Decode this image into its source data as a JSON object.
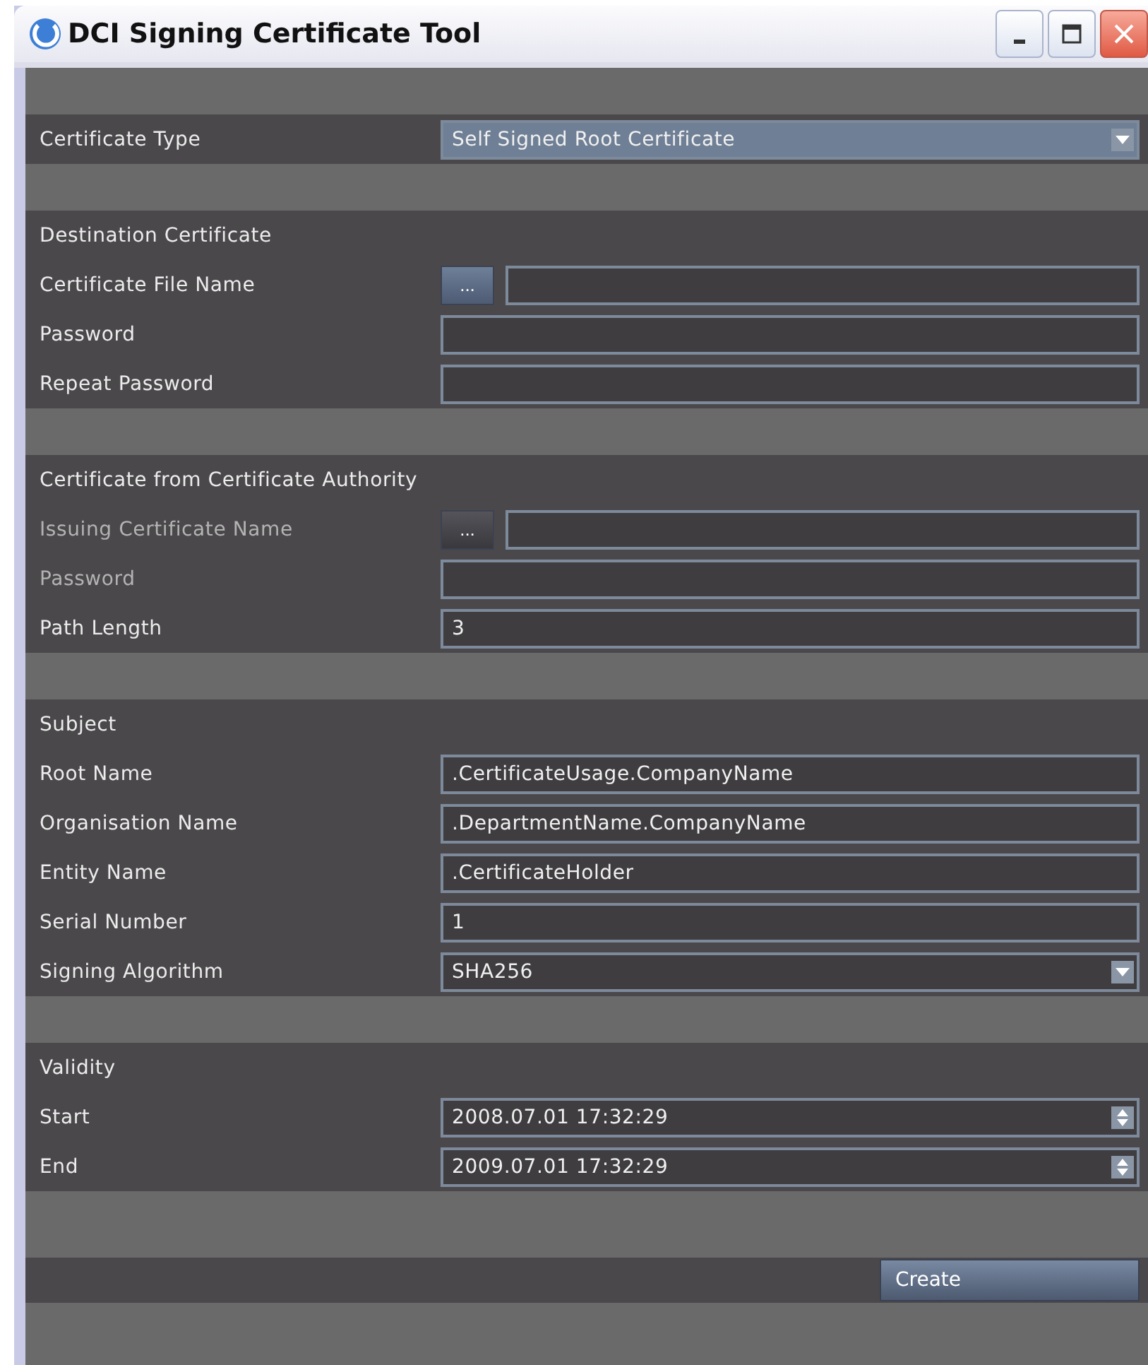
{
  "window": {
    "title": "DCI Signing Certificate Tool"
  },
  "sections": [
    {
      "rows": [
        {
          "label": "Certificate Type",
          "kind": "dropdown",
          "value": "Self Signed Root Certificate",
          "disabled": false,
          "highlighted": true
        }
      ]
    },
    {
      "title": "Destination Certificate",
      "rows": [
        {
          "label": "Certificate File Name",
          "kind": "browse",
          "button": "...",
          "value": "",
          "disabled": false
        },
        {
          "label": "Password",
          "kind": "text",
          "value": "",
          "disabled": false
        },
        {
          "label": "Repeat Password",
          "kind": "text",
          "value": "",
          "disabled": false
        }
      ]
    },
    {
      "title": "Certificate from Certificate Authority",
      "rows": [
        {
          "label": "Issuing Certificate Name",
          "kind": "browse",
          "button": "...",
          "value": "",
          "disabled": true
        },
        {
          "label": "Password",
          "kind": "text",
          "value": "",
          "disabled": true
        },
        {
          "label": "Path Length",
          "kind": "text",
          "value": "3",
          "disabled": false
        }
      ]
    },
    {
      "title": "Subject",
      "rows": [
        {
          "label": "Root Name",
          "kind": "text",
          "value": ".CertificateUsage.CompanyName",
          "disabled": false
        },
        {
          "label": "Organisation Name",
          "kind": "text",
          "value": ".DepartmentName.CompanyName",
          "disabled": false
        },
        {
          "label": "Entity Name",
          "kind": "text",
          "value": ".CertificateHolder",
          "disabled": false
        },
        {
          "label": "Serial Number",
          "kind": "text",
          "value": "1",
          "disabled": false
        },
        {
          "label": "Signing Algorithm",
          "kind": "dropdown",
          "value": "SHA256",
          "disabled": false,
          "highlighted": false
        }
      ]
    },
    {
      "title": "Validity",
      "rows": [
        {
          "label": "Start",
          "kind": "spinner",
          "value": "2008.07.01 17:32:29",
          "disabled": false
        },
        {
          "label": "End",
          "kind": "spinner",
          "value": "2009.07.01 17:32:29",
          "disabled": false
        }
      ]
    }
  ],
  "create_button": "Create"
}
